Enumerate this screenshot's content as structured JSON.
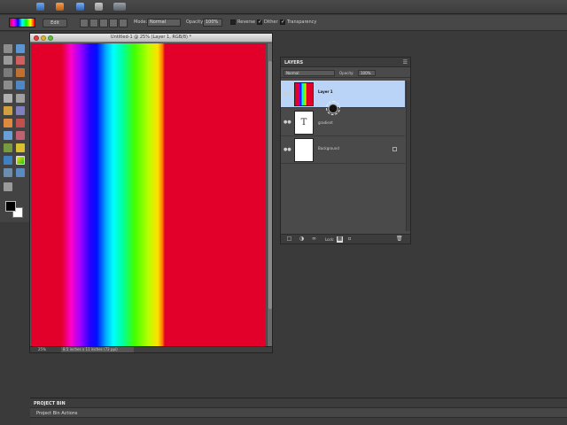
{
  "options_bar": {
    "edit_label": "Edit",
    "mode_label": "Mode:",
    "mode_value": "Normal",
    "opacity_label": "Opacity:",
    "opacity_value": "100%",
    "reverse_label": "Reverse",
    "dither_label": "Dither",
    "transparency_label": "Transparency",
    "reverse_checked": false,
    "dither_checked": true,
    "transparency_checked": true
  },
  "document": {
    "title": "Untitled-1 @ 25% (Layer 1, RGB/8) *",
    "zoom": "25%",
    "dimensions": "8.5 inches x 11 inches (72 ppi)"
  },
  "layers_panel": {
    "title": "LAYERS",
    "blend_mode": "Normal",
    "opacity_label": "Opacity:",
    "opacity_value": "100%",
    "lock_label": "Lock:",
    "layers": [
      {
        "name": "Layer 1",
        "selected": true
      },
      {
        "name": "gradient",
        "selected": false
      },
      {
        "name": "Background",
        "selected": false
      }
    ]
  },
  "project_bin": {
    "title": "PROJECT BIN",
    "actions_label": "Project Bin Actions"
  },
  "colors": {
    "foreground": "#000000",
    "background": "#ffffff",
    "selected_layer": "#b9d4f6"
  }
}
